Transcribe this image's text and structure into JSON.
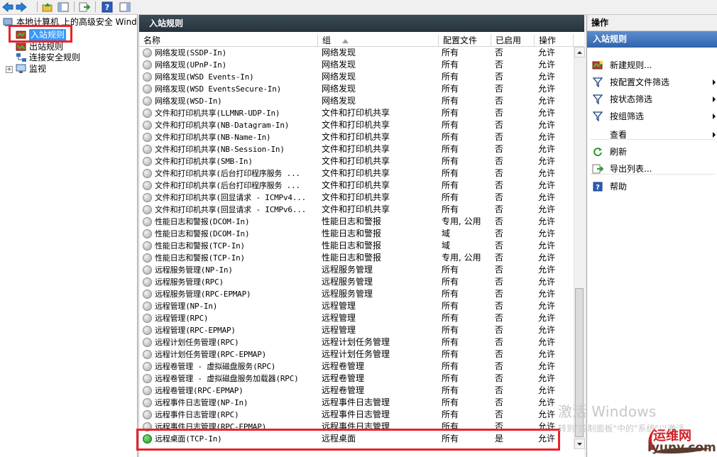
{
  "toolbar": {
    "buttons": [
      "back-icon",
      "forward-icon",
      "up-folder-icon",
      "show-hide-tree-icon",
      "export-list-icon",
      "help-icon",
      "action-pane-icon"
    ]
  },
  "tree": {
    "root": "本地计算机 上的高级安全 Wind",
    "items": [
      "入站规则",
      "出站规则",
      "连接安全规则",
      "监视"
    ]
  },
  "center": {
    "title": "入站规则",
    "columns": [
      "名称",
      "组",
      "配置文件",
      "已启用",
      "操作"
    ],
    "rows": [
      {
        "name": "网络发现(SSDP-In)",
        "group": "网络发现",
        "profile": "所有",
        "enabled": "否",
        "action": "允许",
        "on": false
      },
      {
        "name": "网络发现(UPnP-In)",
        "group": "网络发现",
        "profile": "所有",
        "enabled": "否",
        "action": "允许",
        "on": false
      },
      {
        "name": "网络发现(WSD Events-In)",
        "group": "网络发现",
        "profile": "所有",
        "enabled": "否",
        "action": "允许",
        "on": false
      },
      {
        "name": "网络发现(WSD EventsSecure-In)",
        "group": "网络发现",
        "profile": "所有",
        "enabled": "否",
        "action": "允许",
        "on": false
      },
      {
        "name": "网络发现(WSD-In)",
        "group": "网络发现",
        "profile": "所有",
        "enabled": "否",
        "action": "允许",
        "on": false
      },
      {
        "name": "文件和打印机共享(LLMNR-UDP-In)",
        "group": "文件和打印机共享",
        "profile": "所有",
        "enabled": "否",
        "action": "允许",
        "on": false
      },
      {
        "name": "文件和打印机共享(NB-Datagram-In)",
        "group": "文件和打印机共享",
        "profile": "所有",
        "enabled": "否",
        "action": "允许",
        "on": false
      },
      {
        "name": "文件和打印机共享(NB-Name-In)",
        "group": "文件和打印机共享",
        "profile": "所有",
        "enabled": "否",
        "action": "允许",
        "on": false
      },
      {
        "name": "文件和打印机共享(NB-Session-In)",
        "group": "文件和打印机共享",
        "profile": "所有",
        "enabled": "否",
        "action": "允许",
        "on": false
      },
      {
        "name": "文件和打印机共享(SMB-In)",
        "group": "文件和打印机共享",
        "profile": "所有",
        "enabled": "否",
        "action": "允许",
        "on": false
      },
      {
        "name": "文件和打印机共享(后台打印程序服务 ...",
        "group": "文件和打印机共享",
        "profile": "所有",
        "enabled": "否",
        "action": "允许",
        "on": false
      },
      {
        "name": "文件和打印机共享(后台打印程序服务 ...",
        "group": "文件和打印机共享",
        "profile": "所有",
        "enabled": "否",
        "action": "允许",
        "on": false
      },
      {
        "name": "文件和打印机共享(回显请求 - ICMPv4...",
        "group": "文件和打印机共享",
        "profile": "所有",
        "enabled": "否",
        "action": "允许",
        "on": false
      },
      {
        "name": "文件和打印机共享(回显请求 - ICMPv6...",
        "group": "文件和打印机共享",
        "profile": "所有",
        "enabled": "否",
        "action": "允许",
        "on": false
      },
      {
        "name": "性能日志和警报(DCOM-In)",
        "group": "性能日志和警报",
        "profile": "专用, 公用",
        "enabled": "否",
        "action": "允许",
        "on": false
      },
      {
        "name": "性能日志和警报(DCOM-In)",
        "group": "性能日志和警报",
        "profile": "域",
        "enabled": "否",
        "action": "允许",
        "on": false
      },
      {
        "name": "性能日志和警报(TCP-In)",
        "group": "性能日志和警报",
        "profile": "域",
        "enabled": "否",
        "action": "允许",
        "on": false
      },
      {
        "name": "性能日志和警报(TCP-In)",
        "group": "性能日志和警报",
        "profile": "专用, 公用",
        "enabled": "否",
        "action": "允许",
        "on": false
      },
      {
        "name": "远程服务管理(NP-In)",
        "group": "远程服务管理",
        "profile": "所有",
        "enabled": "否",
        "action": "允许",
        "on": false
      },
      {
        "name": "远程服务管理(RPC)",
        "group": "远程服务管理",
        "profile": "所有",
        "enabled": "否",
        "action": "允许",
        "on": false
      },
      {
        "name": "远程服务管理(RPC-EPMAP)",
        "group": "远程服务管理",
        "profile": "所有",
        "enabled": "否",
        "action": "允许",
        "on": false
      },
      {
        "name": "远程管理(NP-In)",
        "group": "远程管理",
        "profile": "所有",
        "enabled": "否",
        "action": "允许",
        "on": false
      },
      {
        "name": "远程管理(RPC)",
        "group": "远程管理",
        "profile": "所有",
        "enabled": "否",
        "action": "允许",
        "on": false
      },
      {
        "name": "远程管理(RPC-EPMAP)",
        "group": "远程管理",
        "profile": "所有",
        "enabled": "否",
        "action": "允许",
        "on": false
      },
      {
        "name": "远程计划任务管理(RPC)",
        "group": "远程计划任务管理",
        "profile": "所有",
        "enabled": "否",
        "action": "允许",
        "on": false
      },
      {
        "name": "远程计划任务管理(RPC-EPMAP)",
        "group": "远程计划任务管理",
        "profile": "所有",
        "enabled": "否",
        "action": "允许",
        "on": false
      },
      {
        "name": "远程卷管理 - 虚拟磁盘服务(RPC)",
        "group": "远程卷管理",
        "profile": "所有",
        "enabled": "否",
        "action": "允许",
        "on": false
      },
      {
        "name": "远程卷管理 - 虚拟磁盘服务加载器(RPC)",
        "group": "远程卷管理",
        "profile": "所有",
        "enabled": "否",
        "action": "允许",
        "on": false
      },
      {
        "name": "远程卷管理(RPC-EPMAP)",
        "group": "远程卷管理",
        "profile": "所有",
        "enabled": "否",
        "action": "允许",
        "on": false
      },
      {
        "name": "远程事件日志管理(NP-In)",
        "group": "远程事件日志管理",
        "profile": "所有",
        "enabled": "否",
        "action": "允许",
        "on": false
      },
      {
        "name": "远程事件日志管理(RPC)",
        "group": "远程事件日志管理",
        "profile": "所有",
        "enabled": "否",
        "action": "允许",
        "on": false
      },
      {
        "name": "远程事件日志管理(RPC-EPMAP)",
        "group": "远程事件日志管理",
        "profile": "所有",
        "enabled": "否",
        "action": "允许",
        "on": false
      },
      {
        "name": "远程桌面(TCP-In)",
        "group": "远程桌面",
        "profile": "所有",
        "enabled": "是",
        "action": "允许",
        "on": true
      }
    ]
  },
  "actions": {
    "title": "操作",
    "section": "入站规则",
    "items": [
      {
        "label": "新建规则...",
        "icon": "new-rule-icon",
        "submenu": false
      },
      {
        "label": "按配置文件筛选",
        "icon": "filter-icon",
        "submenu": true
      },
      {
        "label": "按状态筛选",
        "icon": "filter-icon",
        "submenu": true
      },
      {
        "label": "按组筛选",
        "icon": "filter-icon",
        "submenu": true
      },
      {
        "label": "查看",
        "icon": "",
        "submenu": true
      },
      {
        "label": "刷新",
        "icon": "refresh-icon",
        "submenu": false
      },
      {
        "label": "导出列表...",
        "icon": "export-list-icon",
        "submenu": false
      },
      {
        "label": "帮助",
        "icon": "help-icon",
        "submenu": false
      }
    ]
  },
  "watermark": {
    "title": "激活 Windows",
    "subtitle": "转到\"控制面板\"中的\"系统\"以激活"
  },
  "site_logo": {
    "name": "运维网",
    "url": "iyunv.com"
  }
}
